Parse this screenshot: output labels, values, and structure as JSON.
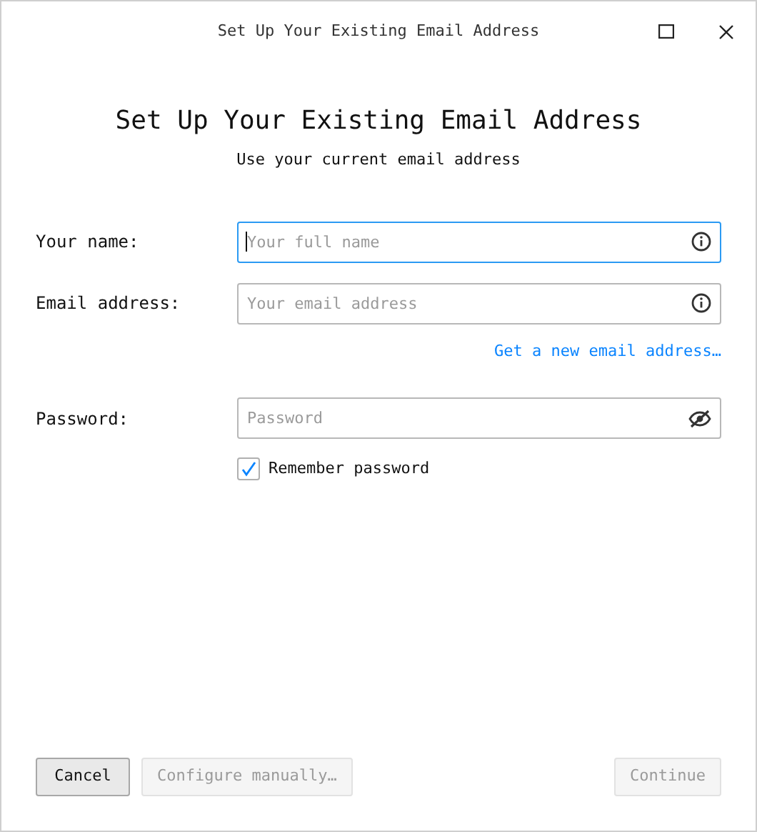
{
  "window": {
    "title": "Set Up Your Existing Email Address"
  },
  "heading": "Set Up Your Existing Email Address",
  "subheading": "Use your current email address",
  "fields": [
    {
      "label": "Your name:",
      "placeholder": "Your full name",
      "focused": true,
      "kind": "info"
    },
    {
      "label": "Email address:",
      "placeholder": "Your email address",
      "focused": false,
      "kind": "info",
      "link": "Get a new email address…"
    },
    {
      "label": "Password:",
      "placeholder": "Password",
      "focused": false,
      "kind": "password"
    }
  ],
  "remember_password": {
    "label": "Remember password",
    "checked": true
  },
  "buttons": [
    {
      "label": "Cancel",
      "disabled": false
    },
    {
      "label": "Configure manually…",
      "disabled": true
    },
    {
      "label": "Continue",
      "disabled": true
    }
  ]
}
